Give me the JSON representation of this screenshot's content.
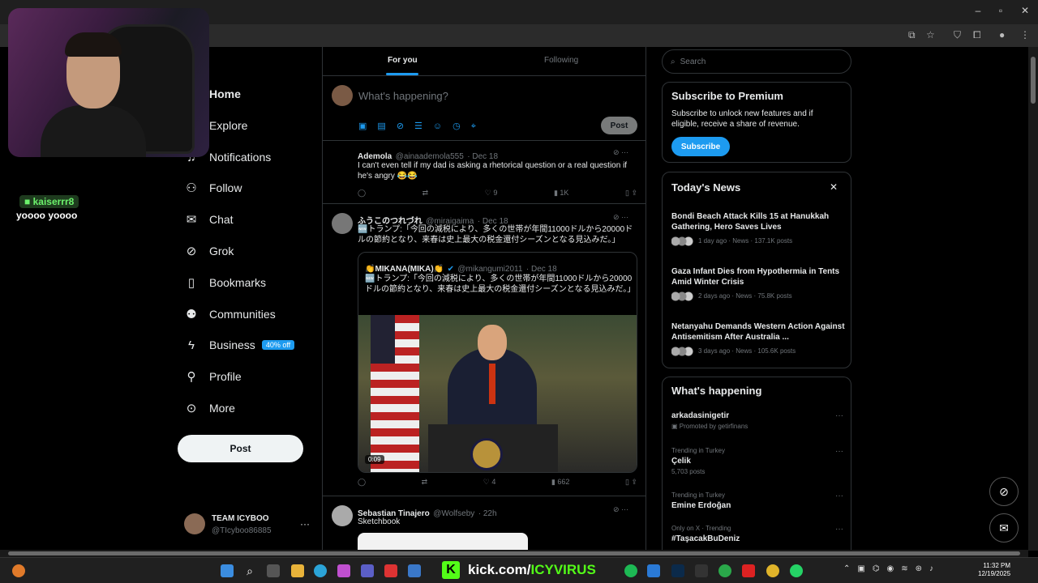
{
  "nav": {
    "items": [
      {
        "label": "Home",
        "icon": "home-icon"
      },
      {
        "label": "Explore",
        "icon": "search-icon"
      },
      {
        "label": "Notifications",
        "icon": "bell-icon"
      },
      {
        "label": "Follow",
        "icon": "person-add-icon"
      },
      {
        "label": "Chat",
        "icon": "mail-icon"
      },
      {
        "label": "Grok",
        "icon": "grok-icon"
      },
      {
        "label": "Bookmarks",
        "icon": "bookmark-icon"
      },
      {
        "label": "Communities",
        "icon": "people-icon"
      },
      {
        "label": "Business",
        "icon": "lightning-icon",
        "badge": "40% off"
      },
      {
        "label": "Profile",
        "icon": "person-icon"
      },
      {
        "label": "More",
        "icon": "more-circle-icon"
      }
    ],
    "post_label": "Post",
    "account": {
      "name": "TEAM ICYBOO",
      "handle": "@TIcyboo86885"
    }
  },
  "stream_chat": {
    "user": "kaiserrr8",
    "message": "yoooo yoooo"
  },
  "timeline": {
    "tab_for_you": "For you",
    "tab_following": "Following",
    "composer": {
      "placeholder": "What's happening?",
      "post_label": "Post"
    },
    "tweets": [
      {
        "name": "Ademola",
        "handle": "@ainaademola555",
        "date": "· Dec 18",
        "text": "I can't even tell if my dad is asking a rhetorical question or a real question if he's angry 😂😂",
        "stats": {
          "reposts": "",
          "likes": "9",
          "views": "1K"
        }
      },
      {
        "name": "ふうこのつれづれ",
        "handle": "@miraigaima",
        "date": "· Dec 18",
        "text": "🆕トランプ:「今回の減税により、多くの世帯が年間11000ドルから20000ドルの節約となり、来春は史上最大の税金還付シーズンとなる見込みだ。」",
        "quote": {
          "name": "👏MIKANA(MIKA)👏",
          "handle": "@mikangumi2011",
          "date": "· Dec 18",
          "text": "🆕トランプ:「今回の減税により、多くの世帯が年間11000ドルから20000ドルの節約となり、来春は史上最大の税金還付シーズンとなる見込みだ。」",
          "video_time": "0:09"
        },
        "stats": {
          "reposts": "",
          "likes": "4",
          "views": "662"
        }
      },
      {
        "name": "Sebastian Tinajero",
        "handle": "@Wolfseby",
        "date": "· 22h",
        "text": "Sketchbook"
      }
    ]
  },
  "sidebar": {
    "search_placeholder": "Search",
    "premium": {
      "title": "Subscribe to Premium",
      "text": "Subscribe to unlock new features and if eligible, receive a share of revenue.",
      "button": "Subscribe"
    },
    "news": {
      "title": "Today's News",
      "items": [
        {
          "title": "Bondi Beach Attack Kills 15 at Hanukkah Gathering, Hero Saves Lives",
          "meta": "1 day ago · News · 137.1K posts"
        },
        {
          "title": "Gaza Infant Dies from Hypothermia in Tents Amid Winter Crisis",
          "meta": "2 days ago · News · 75.8K posts"
        },
        {
          "title": "Netanyahu Demands Western Action Against Antisemitism After Australia ...",
          "meta": "3 days ago · News · 105.6K posts"
        }
      ]
    },
    "happening": {
      "title": "What's happening",
      "items": [
        {
          "pre": "",
          "name": "arkadasinigetir",
          "post": "Promoted by getirfinans"
        },
        {
          "pre": "Trending in Turkey",
          "name": "Çelik",
          "post": "5,703 posts"
        },
        {
          "pre": "Trending in Turkey",
          "name": "Emine Erdoğan",
          "post": ""
        },
        {
          "pre": "Only on X · Trending",
          "name": "#TaşacakBuDeniz",
          "post": ""
        }
      ]
    }
  },
  "taskbar": {
    "kick_prefix": "kick.com/",
    "kick_channel": "ICYVIRUS",
    "time": "11:32 PM",
    "date": "12/19/2025"
  },
  "colors": {
    "accent": "#1d9bf0",
    "kick_green": "#53fc18",
    "background": "#000000"
  }
}
